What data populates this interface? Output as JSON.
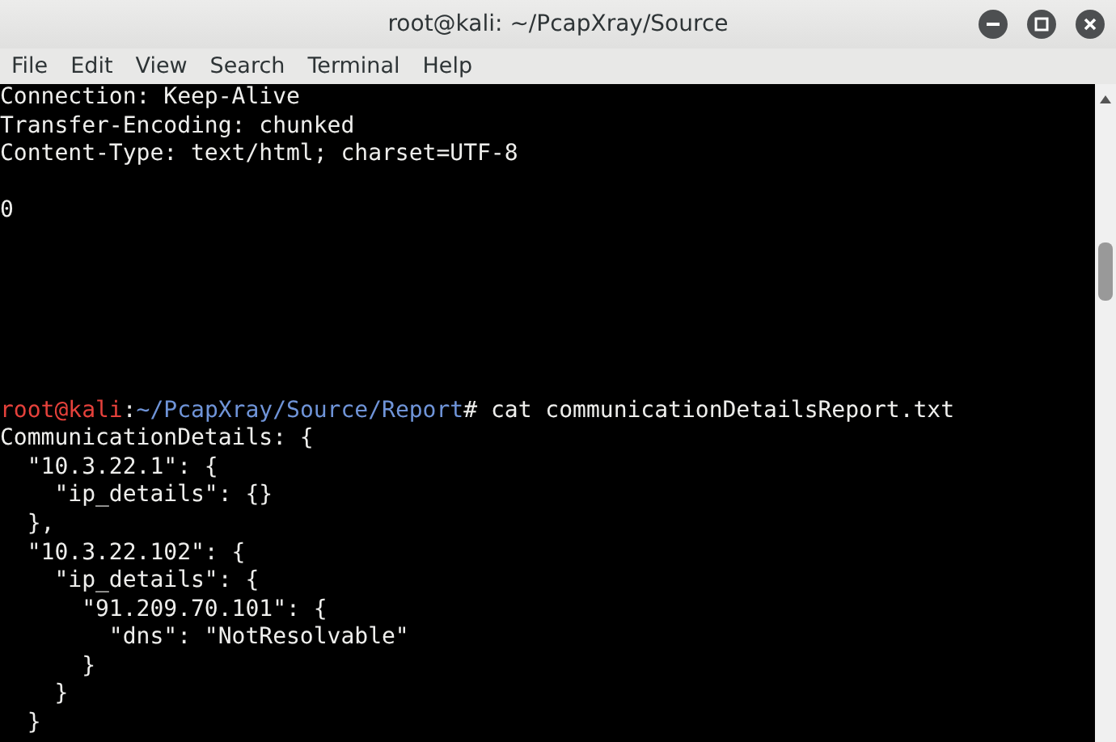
{
  "window": {
    "title": "root@kali: ~/PcapXray/Source"
  },
  "menu": [
    "File",
    "Edit",
    "View",
    "Search",
    "Terminal",
    "Help"
  ],
  "terminal": {
    "lines": [
      {
        "kind": "text",
        "text": "Connection: Keep-Alive"
      },
      {
        "kind": "text",
        "text": "Transfer-Encoding: chunked"
      },
      {
        "kind": "text",
        "text": "Content-Type: text/html; charset=UTF-8"
      },
      {
        "kind": "blank"
      },
      {
        "kind": "text",
        "text": "0"
      },
      {
        "kind": "blank"
      },
      {
        "kind": "blank"
      },
      {
        "kind": "blank"
      },
      {
        "kind": "blank"
      },
      {
        "kind": "blank"
      },
      {
        "kind": "blank"
      },
      {
        "kind": "prompt",
        "user_host": "root@kali",
        "separator": ":",
        "path": "~/PcapXray/Source/Report",
        "symbol": "#",
        "command": "cat communicationDetailsReport.txt"
      },
      {
        "kind": "text",
        "text": "CommunicationDetails: {"
      },
      {
        "kind": "text",
        "text": "  \"10.3.22.1\": {"
      },
      {
        "kind": "text",
        "text": "    \"ip_details\": {}"
      },
      {
        "kind": "text",
        "text": "  },"
      },
      {
        "kind": "text",
        "text": "  \"10.3.22.102\": {"
      },
      {
        "kind": "text",
        "text": "    \"ip_details\": {"
      },
      {
        "kind": "text",
        "text": "      \"91.209.70.101\": {"
      },
      {
        "kind": "text",
        "text": "        \"dns\": \"NotResolvable\""
      },
      {
        "kind": "text",
        "text": "      }"
      },
      {
        "kind": "text",
        "text": "    }"
      },
      {
        "kind": "text",
        "text": "  }"
      }
    ]
  }
}
